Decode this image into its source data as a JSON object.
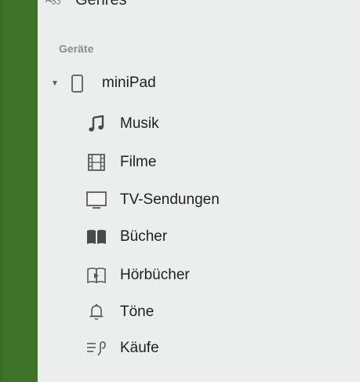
{
  "top_item": {
    "label": "Genres",
    "icon": "genres-icon"
  },
  "section": {
    "title": "Geräte"
  },
  "device": {
    "name": "miniPad",
    "icon": "ipad-icon",
    "expanded": true
  },
  "items": [
    {
      "label": "Musik",
      "icon": "music-note-icon"
    },
    {
      "label": "Filme",
      "icon": "film-icon"
    },
    {
      "label": "TV-Sendungen",
      "icon": "tv-icon"
    },
    {
      "label": "Bücher",
      "icon": "book-icon"
    },
    {
      "label": "Hörbücher",
      "icon": "audiobook-icon"
    },
    {
      "label": "Töne",
      "icon": "bell-icon"
    },
    {
      "label": "Käufe",
      "icon": "purchases-list-icon"
    }
  ],
  "colors": {
    "sidebar_bg": "#eceded",
    "accent_green": "#3f7329",
    "text": "#1f1f1f",
    "header": "#8c8c8c"
  }
}
